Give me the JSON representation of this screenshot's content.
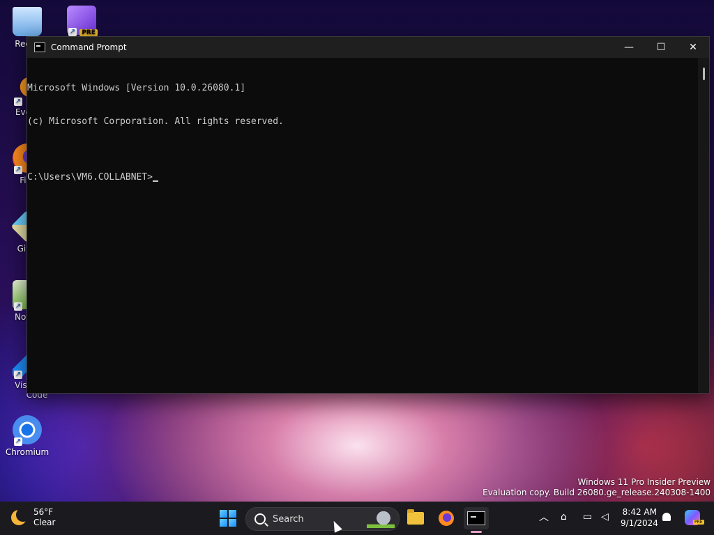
{
  "desktop": {
    "icons": [
      {
        "label": "Recyc",
        "icon": "recycle-bin-icon"
      },
      {
        "label": "",
        "icon": "visual-studio-preview-icon",
        "badge": "PRE"
      },
      {
        "label": "Every",
        "icon": "everything-search-icon"
      },
      {
        "label": "Fire",
        "icon": "firefox-icon"
      },
      {
        "label": "Git E",
        "icon": "git-extensions-icon"
      },
      {
        "label": "Notep",
        "icon": "notepad-plus-plus-icon"
      },
      {
        "label": "Visual",
        "label2": "Code",
        "icon": "vscode-icon"
      },
      {
        "label": "Chromium",
        "icon": "chromium-icon"
      }
    ]
  },
  "window": {
    "title": "Command Prompt",
    "minimize": "—",
    "maximize": "☐",
    "close": "✕",
    "lines": [
      "Microsoft Windows [Version 10.0.26080.1]",
      "(c) Microsoft Corporation. All rights reserved.",
      "",
      "C:\\Users\\VM6.COLLABNET>"
    ]
  },
  "watermark": {
    "line1": "Windows 11 Pro Insider Preview",
    "line2": "Evaluation copy. Build 26080.ge_release.240308-1400"
  },
  "taskbar": {
    "weather_temp": "56°F",
    "weather_cond": "Clear",
    "search_placeholder": "Search",
    "clock_time": "8:42 AM",
    "clock_date": "9/1/2024",
    "copilot_badge": "PRE"
  },
  "colors": {
    "console_bg": "#0c0c0c",
    "console_fg": "#cccccc",
    "taskbar_bg": "#1b1b1f"
  }
}
